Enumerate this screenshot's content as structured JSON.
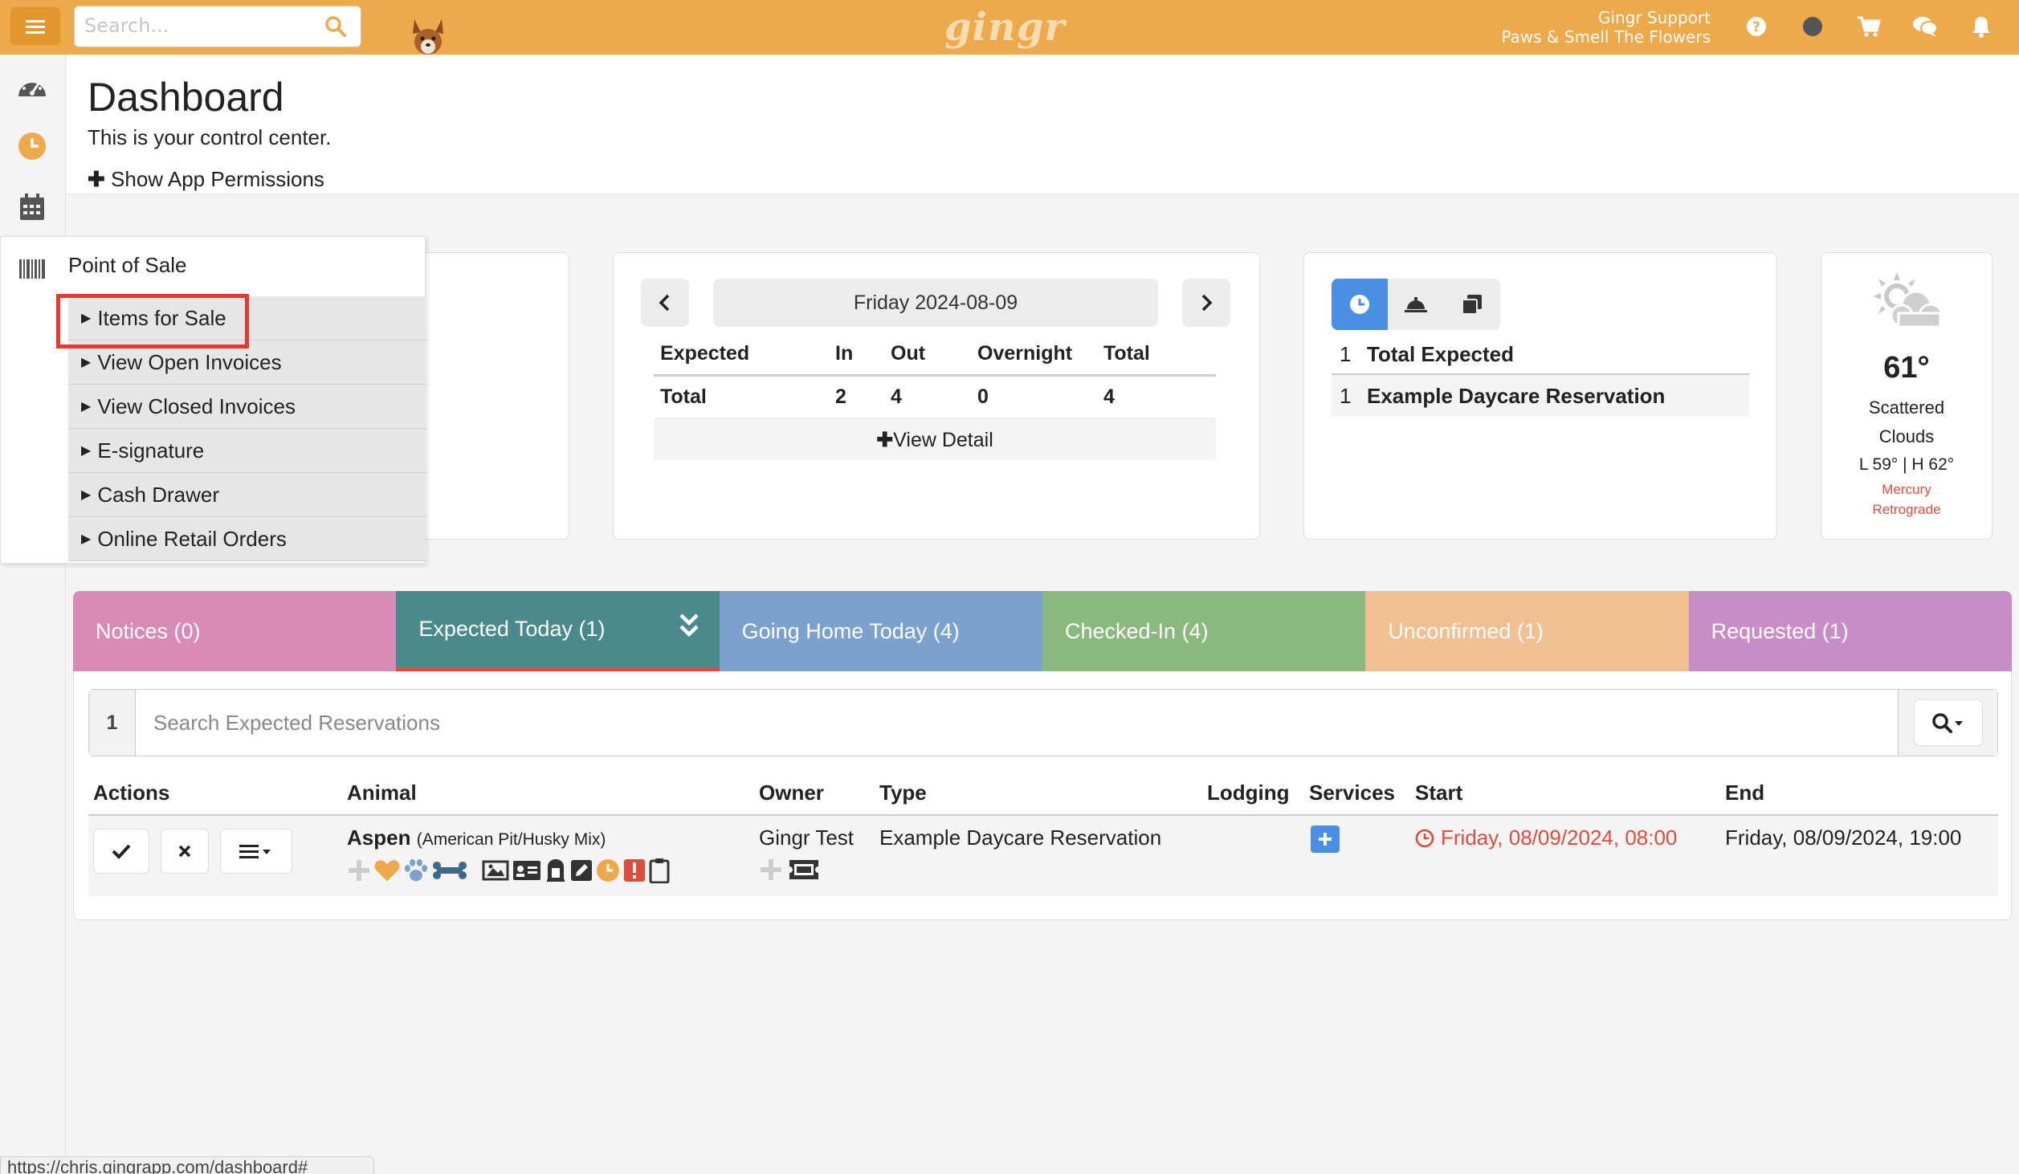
{
  "topbar": {
    "search_placeholder": "Search...",
    "logo": "gingr",
    "user_name": "Gingr Support",
    "location": "Paws & Smell The Flowers"
  },
  "page": {
    "title": "Dashboard",
    "subtitle": "This is your control center.",
    "permissions_link": "Show App Permissions"
  },
  "pos_menu": {
    "title": "Point of Sale",
    "items": [
      "Items for Sale",
      "View Open Invoices",
      "View Closed Invoices",
      "E-signature",
      "Cash Drawer",
      "Online Retail Orders"
    ]
  },
  "date_card": {
    "date": "Friday 2024-08-09",
    "headers": [
      "Expected",
      "In",
      "Out",
      "Overnight",
      "Total"
    ],
    "row": [
      "Total",
      "2",
      "4",
      "0",
      "4"
    ],
    "view_detail": "View Detail"
  },
  "expected_card": {
    "rows": [
      {
        "count": "1",
        "label": "Total Expected"
      },
      {
        "count": "1",
        "label": "Example Daycare Reservation"
      }
    ]
  },
  "weather": {
    "temp": "61°",
    "condition_line1": "Scattered",
    "condition_line2": "Clouds",
    "range": "L 59° | H 62°",
    "alert_line1": "Mercury",
    "alert_line2": "Retrograde"
  },
  "tabs": [
    {
      "label": "Notices (0)",
      "color": "#d88bb5"
    },
    {
      "label": "Expected Today (1)",
      "color": "#4a8a8c"
    },
    {
      "label": "Going Home Today (4)",
      "color": "#7aa2cd"
    },
    {
      "label": "Checked-In (4)",
      "color": "#8bb87e"
    },
    {
      "label": "Unconfirmed (1)",
      "color": "#f0c093"
    },
    {
      "label": "Requested (1)",
      "color": "#c88dc7"
    }
  ],
  "reservations": {
    "count": "1",
    "search_placeholder": "Search Expected Reservations",
    "columns": [
      "Actions",
      "Animal",
      "Owner",
      "Type",
      "Lodging",
      "Services",
      "Start",
      "End"
    ],
    "row": {
      "animal_name": "Aspen",
      "animal_breed": "(American Pit/Husky Mix)",
      "owner": "Gingr Test",
      "type": "Example Daycare Reservation",
      "lodging": "",
      "start": "Friday, 08/09/2024, 08:00",
      "end": "Friday, 08/09/2024, 19:00"
    }
  },
  "status_bar": {
    "url": "https://chris.gingrapp.com/dashboard#"
  },
  "colors": {
    "topbar": "#eda94a",
    "accent_blue": "#4a90e2",
    "alert_red": "#e04b3c"
  }
}
